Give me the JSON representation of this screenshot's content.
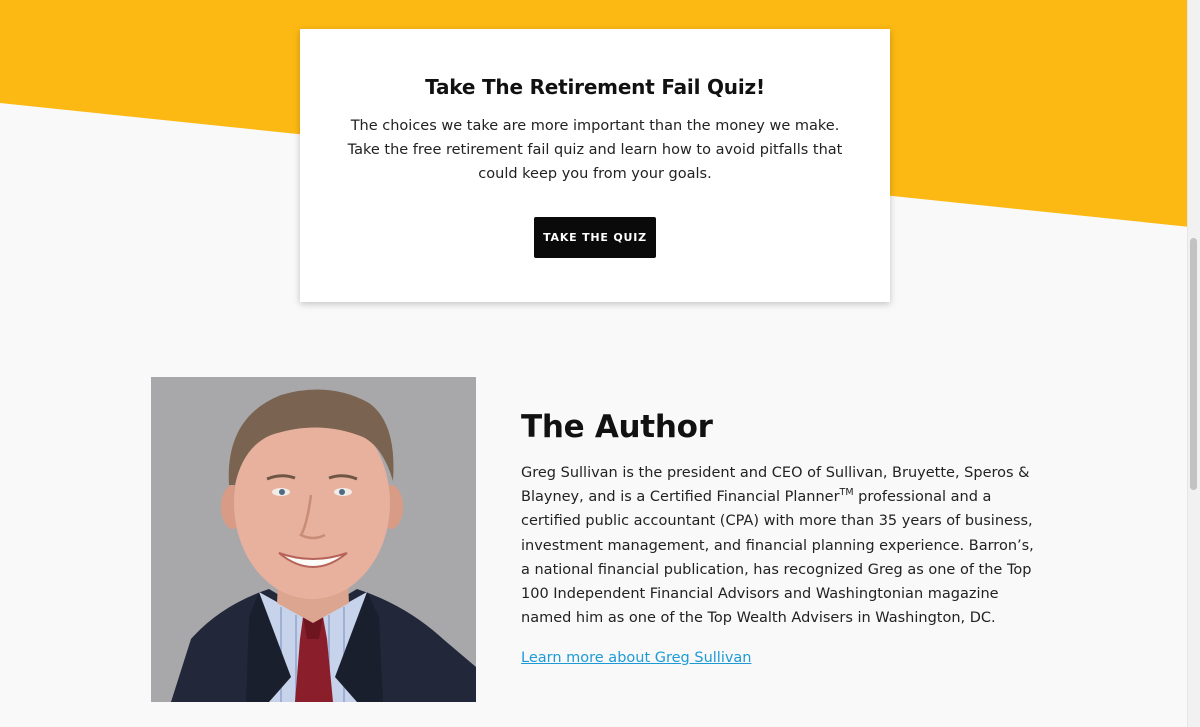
{
  "colors": {
    "accent_yellow": "#fdb913",
    "background": "#f9f9f9",
    "button": "#0a0a0a",
    "link": "#1e9bd7"
  },
  "quiz": {
    "title": "Take The Retirement Fail Quiz!",
    "description": "The choices we take are more important than the money we make. Take the free retirement fail quiz and learn how to avoid pitfalls that could keep you from your goals.",
    "button_label": "TAKE THE QUIZ"
  },
  "author": {
    "heading": "The Author",
    "bio_part1": "Greg Sullivan is the president and CEO of Sullivan, Bruyette, Speros & Blayney, and is a Certified Financial Planner",
    "bio_trademark": "TM",
    "bio_part2": " professional and a certified public accountant (CPA) with more than 35 years of business, investment management, and financial planning experience. Barron’s, a national financial publication, has recognized Greg as one of the Top 100 Independent Financial Advisors and Washingtonian magazine named him as one of the Top Wealth Advisers in Washington, DC.",
    "link_text": "Learn more about Greg Sullivan"
  }
}
